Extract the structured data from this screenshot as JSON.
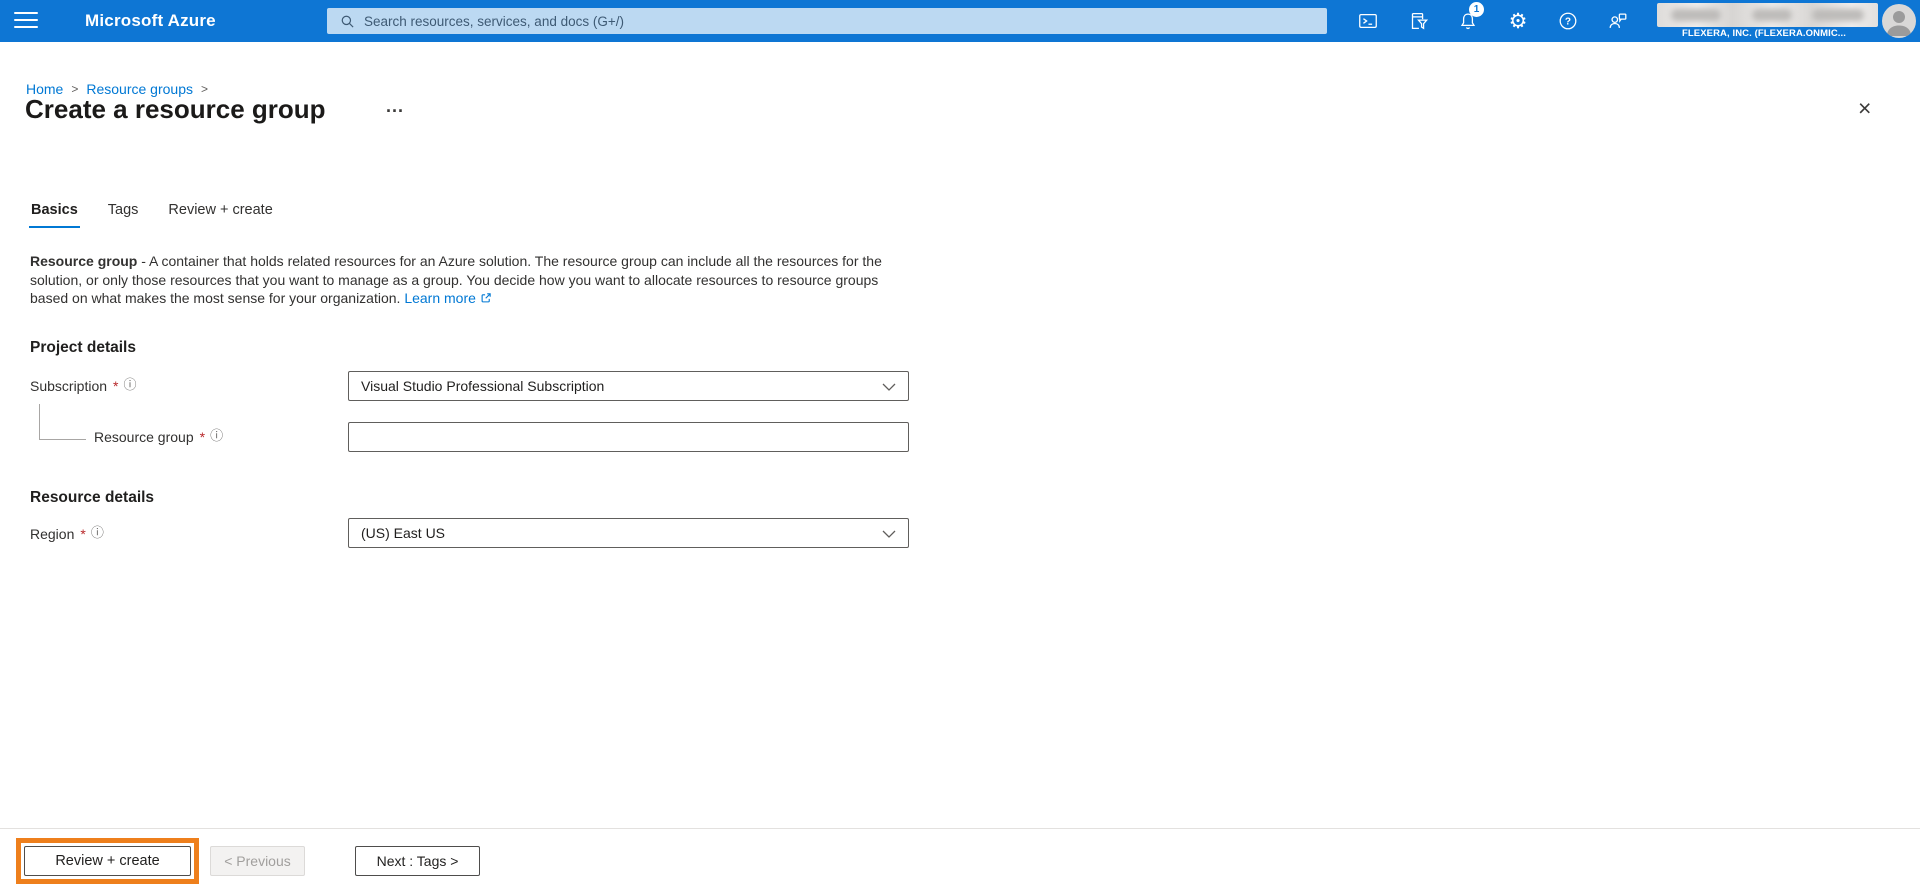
{
  "topbar": {
    "brand": "Microsoft Azure",
    "search_placeholder": "Search resources, services, and docs (G+/)",
    "notification_count": "1",
    "tenant_name": "FLEXERA, INC. (FLEXERA.ONMIC...",
    "icons": [
      "cloud-shell",
      "directory-filter",
      "notifications",
      "settings",
      "help",
      "feedback"
    ]
  },
  "breadcrumb": {
    "items": [
      {
        "label": "Home"
      },
      {
        "label": "Resource groups"
      }
    ],
    "separator": ">"
  },
  "page": {
    "title": "Create a resource group",
    "ellipsis": "...",
    "close": "×"
  },
  "tabs": [
    {
      "label": "Basics",
      "active": true
    },
    {
      "label": "Tags",
      "active": false
    },
    {
      "label": "Review + create",
      "active": false
    }
  ],
  "description": {
    "lead": "Resource group",
    "body": " - A container that holds related resources for an Azure solution. The resource group can include all the resources for the solution, or only those resources that you want to manage as a group. You decide how you want to allocate resources to resource groups based on what makes the most sense for your organization. ",
    "link": "Learn more"
  },
  "sections": {
    "project": {
      "heading": "Project details",
      "subscription": {
        "label": "Subscription",
        "required": "*",
        "value": "Visual Studio Professional Subscription"
      },
      "resource_group": {
        "label": "Resource group",
        "required": "*",
        "value": "",
        "placeholder": ""
      }
    },
    "resource": {
      "heading": "Resource details",
      "region": {
        "label": "Region",
        "required": "*",
        "value": "(US) East US"
      }
    }
  },
  "footer": {
    "review_create": "Review + create",
    "previous": "< Previous",
    "previous_disabled": true,
    "next": "Next : Tags >"
  },
  "colors": {
    "topbar": "#0e76d4",
    "accent": "#0078d4",
    "searchbox": "#bcd9f2",
    "highlight_orange": "#ee7f1c",
    "required_red": "#b8282b"
  }
}
